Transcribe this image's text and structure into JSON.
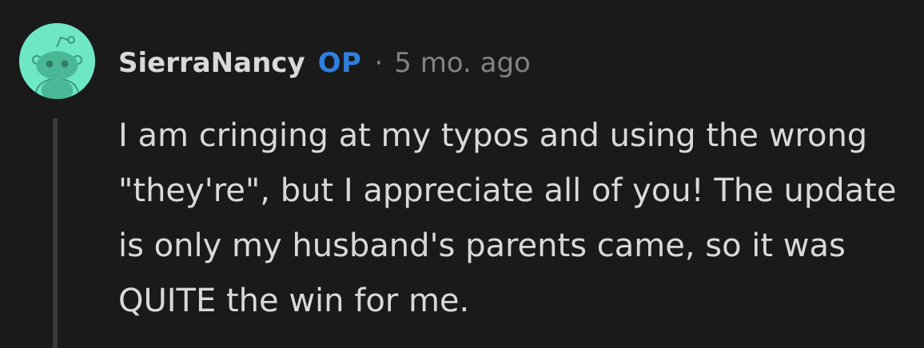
{
  "comment": {
    "author": "SierraNancy",
    "op_badge": "OP",
    "separator": "·",
    "timestamp": "5 mo. ago",
    "body": "I am cringing at my typos and using the wrong \"they're\", but I appreciate all of you! The update is only my husband's parents came, so it was QUITE the win for me."
  },
  "avatar": {
    "icon": "snoo-avatar-icon",
    "background_color": "#6ee7c5"
  },
  "colors": {
    "background": "#1a1a1b",
    "text": "#d7dadc",
    "muted": "#818384",
    "op_badge": "#2f7fdd",
    "thread_line": "#3a3a3c"
  }
}
